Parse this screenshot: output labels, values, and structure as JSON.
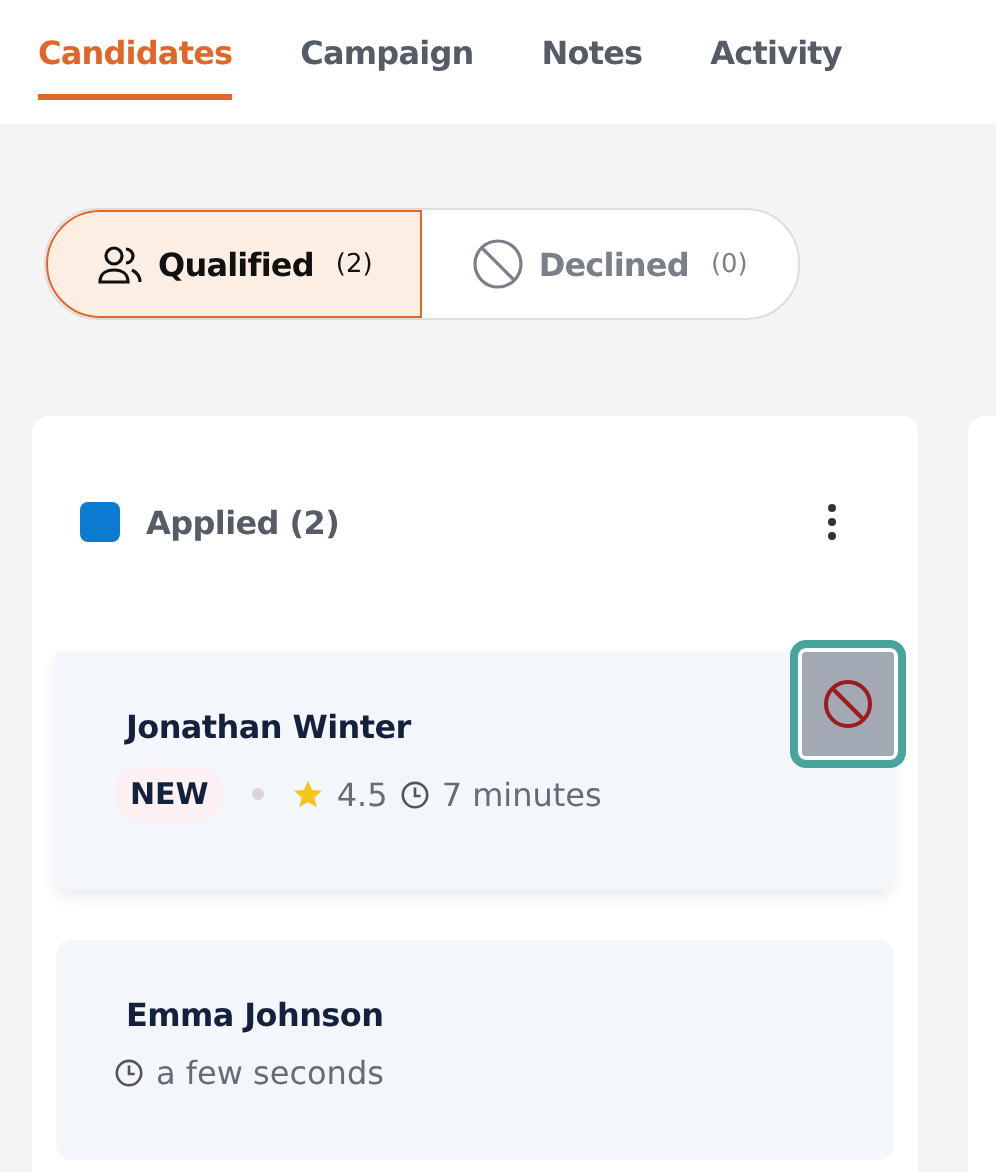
{
  "tabs": [
    {
      "label": "Candidates",
      "selected": true
    },
    {
      "label": "Campaign",
      "selected": false
    },
    {
      "label": "Notes",
      "selected": false
    },
    {
      "label": "Activity",
      "selected": false
    }
  ],
  "filters": [
    {
      "kind": "people",
      "label": "Qualified",
      "count": "(2)",
      "selected": true
    },
    {
      "kind": "blocked",
      "label": "Declined",
      "count": "(0)",
      "selected": false
    }
  ],
  "column": {
    "title": "Applied (2)",
    "color": "#0a7bd1",
    "candidates": [
      {
        "name": "Jonathan Winter",
        "badge": "NEW",
        "rating": "4.5",
        "time": "7 minutes",
        "hovered": true
      },
      {
        "name": "Emma Johnson",
        "time": "a few seconds",
        "hovered": false
      }
    ]
  }
}
